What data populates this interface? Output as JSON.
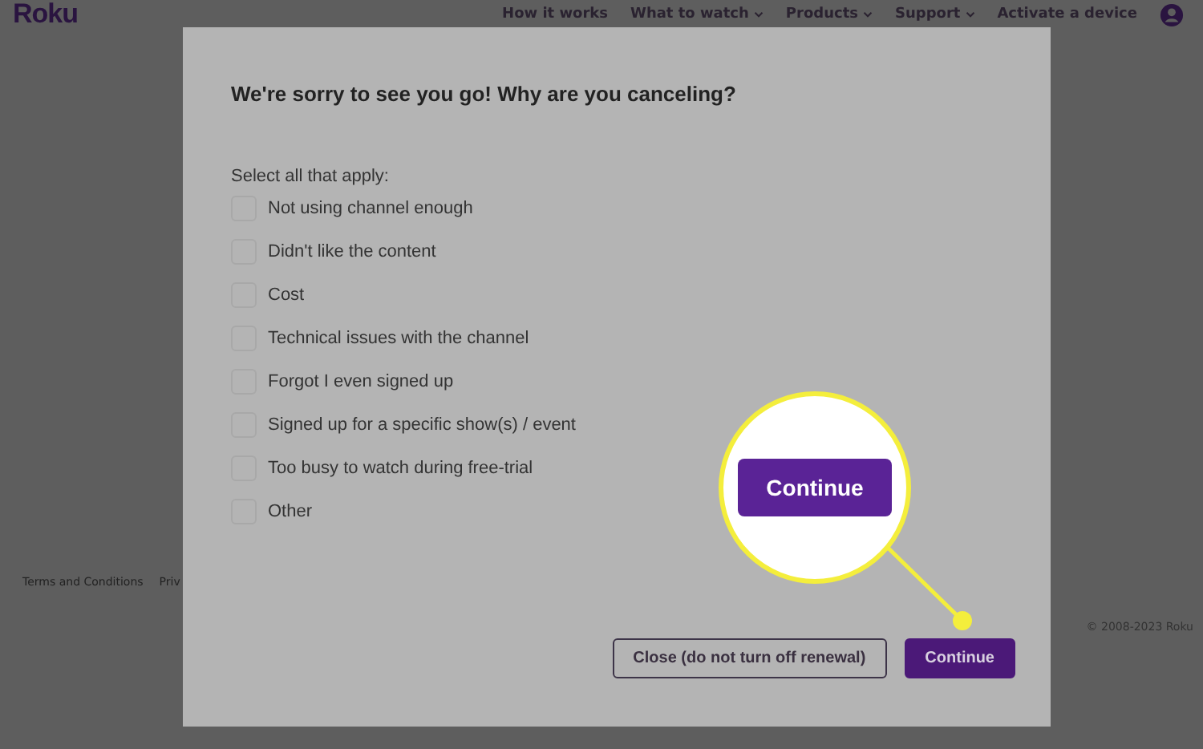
{
  "header": {
    "logo": "Roku",
    "nav": [
      {
        "label": "How it works",
        "dropdown": false
      },
      {
        "label": "What to watch",
        "dropdown": true
      },
      {
        "label": "Products",
        "dropdown": true
      },
      {
        "label": "Support",
        "dropdown": true
      },
      {
        "label": "Activate a device",
        "dropdown": false
      }
    ]
  },
  "footer": {
    "links": [
      "Terms and Conditions",
      "Priv"
    ],
    "copyright": "© 2008-2023 Roku"
  },
  "dialog": {
    "title": "We're sorry to see you go! Why are you canceling?",
    "instruction": "Select all that apply:",
    "options": [
      {
        "label": "Not using channel enough",
        "checked": false
      },
      {
        "label": "Didn't like the content",
        "checked": false
      },
      {
        "label": "Cost",
        "checked": false
      },
      {
        "label": "Technical issues with the channel",
        "checked": false
      },
      {
        "label": "Forgot I even signed up",
        "checked": false
      },
      {
        "label": "Signed up for a specific show(s) / event",
        "checked": false
      },
      {
        "label": "Too busy to watch during free-trial",
        "checked": false
      },
      {
        "label": "Other",
        "checked": false
      }
    ],
    "buttons": [
      {
        "label": "Close (do not turn off renewal)",
        "kind": "secondary"
      },
      {
        "label": "Continue",
        "kind": "primary"
      }
    ]
  },
  "callout": {
    "label": "Continue"
  }
}
